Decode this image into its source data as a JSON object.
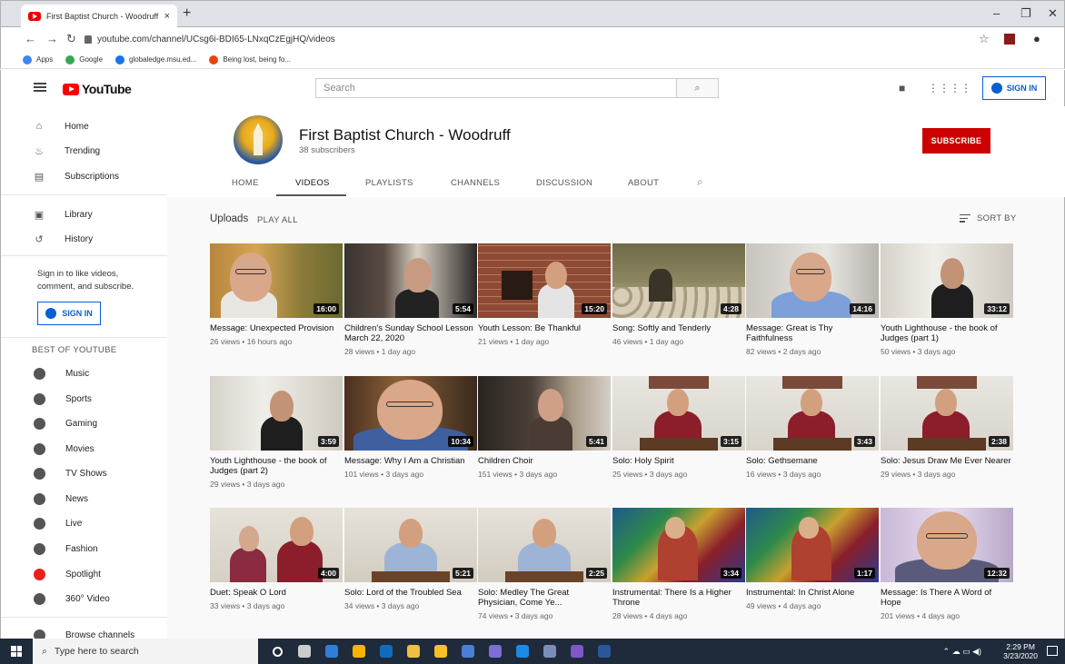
{
  "browser": {
    "tab_title": "First Baptist Church - Woodruff -",
    "tab_close": "×",
    "new_tab": "+",
    "url": "youtube.com/channel/UCsg6i-BDI65-LNxqCzEgjHQ/videos",
    "bookmarks": [
      {
        "label": "Apps",
        "color": "#4285f4"
      },
      {
        "label": "Google",
        "color": "#34a853"
      },
      {
        "label": "globaledge.msu.ed...",
        "color": "#1a73e8"
      },
      {
        "label": "Being lost, being fo...",
        "color": "#e8430f"
      }
    ]
  },
  "masthead": {
    "logo_text": "YouTube",
    "search_placeholder": "Search",
    "sign_in": "SIGN IN"
  },
  "sidebar": {
    "main_items": [
      {
        "label": "Home",
        "icon": "home-icon",
        "glyph": "⌂"
      },
      {
        "label": "Trending",
        "icon": "trending-icon",
        "glyph": "♨"
      },
      {
        "label": "Subscriptions",
        "icon": "subscriptions-icon",
        "glyph": "▤"
      }
    ],
    "library_items": [
      {
        "label": "Library",
        "icon": "library-icon",
        "glyph": "▣"
      },
      {
        "label": "History",
        "icon": "history-icon",
        "glyph": "↺"
      }
    ],
    "signin_note": "Sign in to like videos, comment, and subscribe.",
    "signin_button": "SIGN IN",
    "best_heading": "BEST OF YOUTUBE",
    "best_items": [
      {
        "label": "Music",
        "icon": "music-icon"
      },
      {
        "label": "Sports",
        "icon": "sports-icon"
      },
      {
        "label": "Gaming",
        "icon": "gaming-icon"
      },
      {
        "label": "Movies",
        "icon": "movies-icon"
      },
      {
        "label": "TV Shows",
        "icon": "tv-shows-icon"
      },
      {
        "label": "News",
        "icon": "news-icon"
      },
      {
        "label": "Live",
        "icon": "live-icon"
      },
      {
        "label": "Fashion",
        "icon": "fashion-icon"
      },
      {
        "label": "Spotlight",
        "icon": "spotlight-icon"
      },
      {
        "label": "360° Video",
        "icon": "360-video-icon"
      }
    ],
    "browse_channels": "Browse channels"
  },
  "channel": {
    "name": "First Baptist Church - Woodruff",
    "subscribers": "38 subscribers",
    "subscribe": "SUBSCRIBE",
    "tabs": [
      "HOME",
      "VIDEOS",
      "PLAYLISTS",
      "CHANNELS",
      "DISCUSSION",
      "ABOUT"
    ],
    "active_tab": "VIDEOS"
  },
  "uploads": {
    "heading": "Uploads",
    "play_all": "PLAY ALL",
    "sort_by": "SORT BY"
  },
  "videos": [
    {
      "title": "Message: Unexpected Provision",
      "meta": "26 views • 16 hours ago",
      "duration": "16:00",
      "scene": "portrait-outdoor"
    },
    {
      "title": "Children's Sunday School Lesson March 22, 2020",
      "meta": "28 views • 1 day ago",
      "duration": "5:54",
      "scene": "woman-room"
    },
    {
      "title": "Youth Lesson: Be Thankful",
      "meta": "21 views • 1 day ago",
      "duration": "15:20",
      "scene": "brick-fireplace"
    },
    {
      "title": "Song: Softly and Tenderly",
      "meta": "46 views • 1 day ago",
      "duration": "4:28",
      "scene": "sheep-field"
    },
    {
      "title": "Message: Great is Thy Faithfulness",
      "meta": "82 views • 2 days ago",
      "duration": "14:16",
      "scene": "man-office"
    },
    {
      "title": "Youth Lighthouse - the book of Judges (part 1)",
      "meta": "50 views • 3 days ago",
      "duration": "33:12",
      "scene": "man-dark"
    },
    {
      "title": "Youth Lighthouse - the book of Judges (part 2)",
      "meta": "29 views • 3 days ago",
      "duration": "3:59",
      "scene": "man-dark"
    },
    {
      "title": "Message: Why I Am a Christian",
      "meta": "101 views • 3 days ago",
      "duration": "10:34",
      "scene": "man-closeup"
    },
    {
      "title": "Children Choir",
      "meta": "151 views • 3 days ago",
      "duration": "5:41",
      "scene": "woman-guitar"
    },
    {
      "title": "Solo: Holy Spirit",
      "meta": "25 views • 3 days ago",
      "duration": "3:15",
      "scene": "pulpit"
    },
    {
      "title": "Solo: Gethsemane",
      "meta": "16 views • 3 days ago",
      "duration": "3:43",
      "scene": "pulpit"
    },
    {
      "title": "Solo: Jesus Draw Me Ever Nearer",
      "meta": "29 views • 3 days ago",
      "duration": "2:38",
      "scene": "pulpit"
    },
    {
      "title": "Duet: Speak O Lord",
      "meta": "33 views • 3 days ago",
      "duration": "4:00",
      "scene": "duet"
    },
    {
      "title": "Solo: Lord of the Troubled Sea",
      "meta": "34 views • 3 days ago",
      "duration": "5:21",
      "scene": "singer-blue"
    },
    {
      "title": "Solo: Medley The Great Physician, Come Ye...",
      "meta": "74 views • 3 days ago",
      "duration": "2:25",
      "scene": "singer-blue"
    },
    {
      "title": "Instrumental: There Is a Higher Throne",
      "meta": "28 views • 4 days ago",
      "duration": "3:34",
      "scene": "stained-glass"
    },
    {
      "title": "Instrumental: In Christ Alone",
      "meta": "49 views • 4 days ago",
      "duration": "1:17",
      "scene": "stained-glass"
    },
    {
      "title": "Message: Is There A Word of Hope",
      "meta": "201 views • 4 days ago",
      "duration": "12:32",
      "scene": "man-closeup-purple"
    }
  ],
  "taskbar": {
    "search_placeholder": "Type here to search",
    "time": "2:29 PM",
    "date": "3/23/2020",
    "apps": [
      {
        "icon": "cortana-icon",
        "color": "#ffffff"
      },
      {
        "icon": "task-view-icon",
        "color": "#cccccc"
      },
      {
        "icon": "edge-icon",
        "color": "#2f7fd8"
      },
      {
        "icon": "chrome-icon",
        "color": "#f4b400"
      },
      {
        "icon": "outlook-icon",
        "color": "#0f6cbd"
      },
      {
        "icon": "file-explorer-icon",
        "color": "#f0c040"
      },
      {
        "icon": "sticky-icon",
        "color": "#f6c026"
      },
      {
        "icon": "app-blue-icon",
        "color": "#4a7fd6"
      },
      {
        "icon": "app-purple-icon",
        "color": "#7b6fd6"
      },
      {
        "icon": "kindle-icon",
        "color": "#1e88e5"
      },
      {
        "icon": "visio-icon",
        "color": "#7a8fb8"
      },
      {
        "icon": "onenote-icon",
        "color": "#7f57c8"
      },
      {
        "icon": "word-icon",
        "color": "#2b579a"
      }
    ]
  }
}
